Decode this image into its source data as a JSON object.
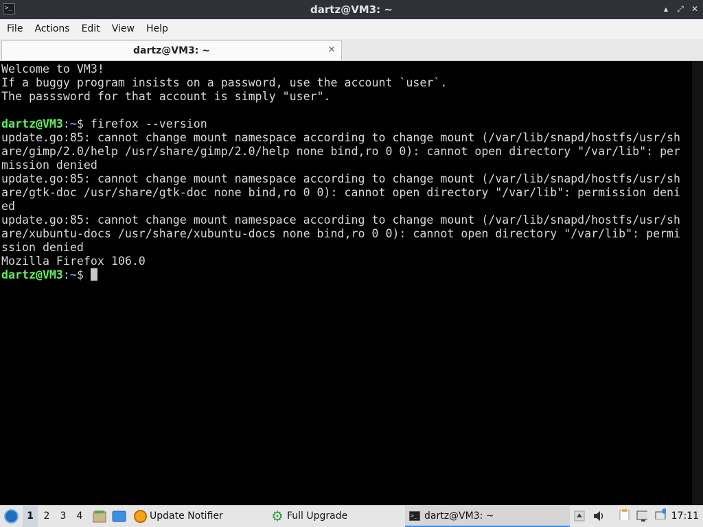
{
  "window": {
    "title": "dartz@VM3: ~",
    "app_icon_glyph": ">_",
    "buttons": {
      "minimize": "▴",
      "maximize": "⤢",
      "close": "✕"
    }
  },
  "menubar": {
    "items": [
      "File",
      "Actions",
      "Edit",
      "View",
      "Help"
    ]
  },
  "tabs": [
    {
      "label": "dartz@VM3: ~",
      "active": true,
      "close_glyph": "×"
    }
  ],
  "terminal": {
    "colors": {
      "user": "#5ef25e",
      "path": "#6b9fff",
      "text": "#d8d8d8",
      "background": "#000000"
    },
    "lines": [
      {
        "type": "text",
        "text": "Welcome to VM3!"
      },
      {
        "type": "text",
        "text": "If a buggy program insists on a password, use the account `user`."
      },
      {
        "type": "text",
        "text": "The passsword for that account is simply \"user\"."
      },
      {
        "type": "text",
        "text": ""
      },
      {
        "type": "prompt",
        "user": "dartz@VM3",
        "sep": ":",
        "path": "~",
        "sym": "$ ",
        "cmd": "firefox --version"
      },
      {
        "type": "text",
        "text": "update.go:85: cannot change mount namespace according to change mount (/var/lib/snapd/hostfs/usr/sh"
      },
      {
        "type": "text",
        "text": "are/gimp/2.0/help /usr/share/gimp/2.0/help none bind,ro 0 0): cannot open directory \"/var/lib\": per"
      },
      {
        "type": "text",
        "text": "mission denied"
      },
      {
        "type": "text",
        "text": "update.go:85: cannot change mount namespace according to change mount (/var/lib/snapd/hostfs/usr/sh"
      },
      {
        "type": "text",
        "text": "are/gtk-doc /usr/share/gtk-doc none bind,ro 0 0): cannot open directory \"/var/lib\": permission deni"
      },
      {
        "type": "text",
        "text": "ed"
      },
      {
        "type": "text",
        "text": "update.go:85: cannot change mount namespace according to change mount (/var/lib/snapd/hostfs/usr/sh"
      },
      {
        "type": "text",
        "text": "are/xubuntu-docs /usr/share/xubuntu-docs none bind,ro 0 0): cannot open directory \"/var/lib\": permi"
      },
      {
        "type": "text",
        "text": "ssion denied"
      },
      {
        "type": "text",
        "text": "Mozilla Firefox 106.0"
      },
      {
        "type": "prompt",
        "user": "dartz@VM3",
        "sep": ":",
        "path": "~",
        "sym": "$ ",
        "cmd": "",
        "cursor": true
      }
    ]
  },
  "taskbar": {
    "workspaces": [
      {
        "label": "1",
        "active": true
      },
      {
        "label": "2",
        "active": false
      },
      {
        "label": "3",
        "active": false
      },
      {
        "label": "4",
        "active": false
      }
    ],
    "update_notifier_label": "Update Notifier",
    "full_upgrade_label": "Full Upgrade",
    "terminal_task_label": "dartz@VM3: ~",
    "clock": "17:11"
  }
}
